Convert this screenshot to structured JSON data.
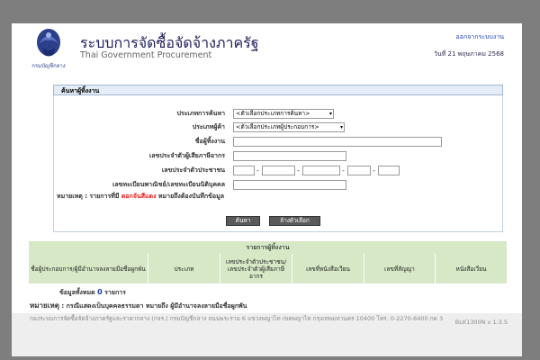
{
  "header": {
    "title_th": "ระบบการจัดซื้อจัดจ้างภาครัฐ",
    "title_en": "Thai Government Procurement",
    "logout_label": "ออกจากระบบงาน",
    "date_text": "วันที่ 21 พฤษภาคม 2568",
    "logo_caption": "กรมบัญชีกลาง"
  },
  "search": {
    "section_title": "ค้นหาผู้ทิ้งงาน",
    "fields": {
      "search_type": {
        "label": "ประเภทการค้นหา",
        "value": "<ตัวเลือกประเภทการค้นหา>"
      },
      "vendor_type": {
        "label": "ประเภทผู้ค้า",
        "value": "<ตัวเลือกประเภทผู้ประกอบการ>"
      },
      "vendor_name": {
        "label": "ชื่อผู้ทิ้งงาน",
        "value": ""
      },
      "tax_id": {
        "label": "เลขประจำตัวผู้เสียภาษีอากร",
        "value": ""
      },
      "citizen_id": {
        "label": "เลขประจำตัวประชาชน",
        "value": ""
      },
      "registration_no": {
        "label": "เลขทะเบียนพาณิชย์/เลขทะเบียนนิติบุคคล",
        "value": ""
      }
    },
    "note_prefix": "หมายเหตุ : รายการที่มี ",
    "note_red": "ดอกจันสีแดง",
    "note_suffix": " หมายถึงต้องบันทึกข้อมูล",
    "search_button": "ค้นหา",
    "clear_button": "ล้างตัวเลือก"
  },
  "results": {
    "title": "รายการผู้ทิ้งงาน",
    "columns": [
      "ชื่อผู้ประกอบการ/ผู้มีอำนาจลงลายมือชื่อผูกพัน",
      "ประเภท",
      "เลขประจำตัวประชาชน/ เลขประจำตัวผู้เสียภาษีอากร",
      "เลขที่หนังสือเวียน",
      "เลขที่สัญญา",
      "หนังสือเวียน"
    ],
    "total_prefix": "ข้อมูลทั้งหมด",
    "total_count": "0",
    "total_suffix": "รายการ",
    "remark_label": "หมายเหตุ",
    "remark_text": " : กรณีแสดงเป็นบุคคลธรรมดา หมายถึง ผู้มีอำนาจลงลายมือชื่อผูกพัน"
  },
  "footer": {
    "address": "กองระบบการจัดซื้อจัดจ้างภาครัฐและราคากลาง (กจร.) กรมบัญชีกลาง ถนนพระราม 6 แขวงพญาไท เขตพญาไท กรุงเทพมหานคร 10400 โทร. 0-2270-6400 กด 3",
    "version": "BLK1300N v 1.3.5"
  },
  "colors": {
    "background": "#7e7e7e",
    "section_head": "#e3ecf7",
    "table_head": "#d6e8c6",
    "required_red": "#e21b1b",
    "link_blue": "#2447b5"
  }
}
